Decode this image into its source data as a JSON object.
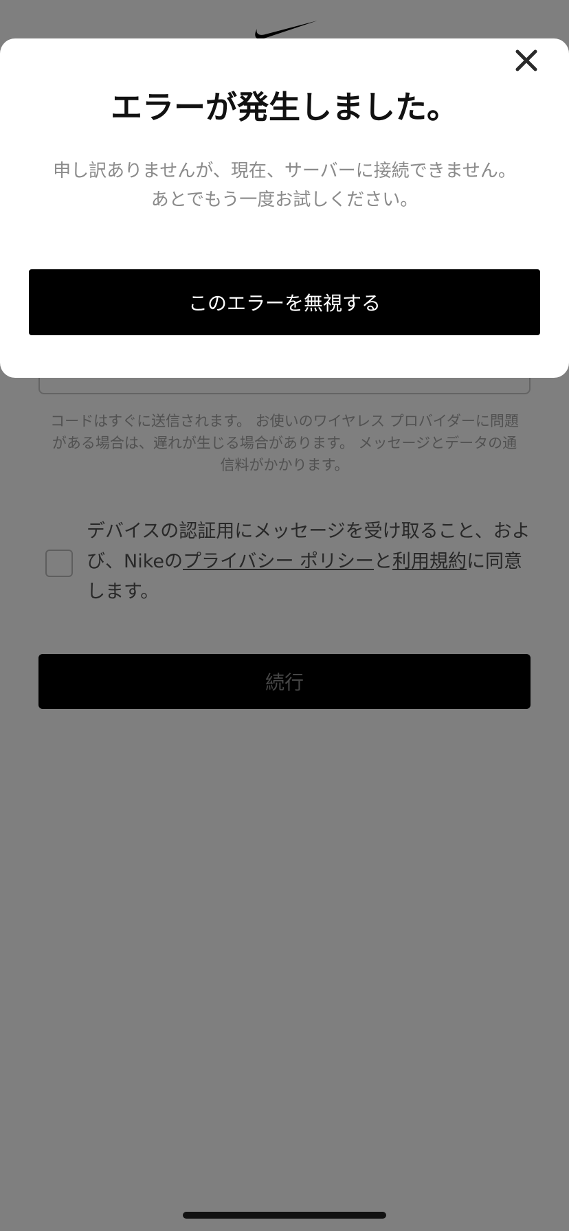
{
  "header": {
    "logo_icon": "nike-swoosh-icon"
  },
  "modal": {
    "close_icon": "close-icon",
    "title": "エラーが発生しました。",
    "message_line1": "申し訳ありませんが、現在、サーバーに接続できません。",
    "message_line2": "あとでもう一度お試しください。",
    "ignore_button_label": "このエラーを無視する"
  },
  "form": {
    "info_line1": "コードはすぐに送信されます。 お使いのワイヤレス プロバイダーに問題",
    "info_line2": "がある場合は、遅れが生じる場合があります。 メッセージとデータの通",
    "info_line3": "信料がかかります。",
    "consent_part1": "デバイスの認証用にメッセージを受け取ること、および、Nikeの",
    "consent_link_privacy": "プライバシー ポリシー",
    "consent_part2": "と",
    "consent_link_terms": "利用規約",
    "consent_part3": "に同意します。",
    "consent_checked": false,
    "continue_label": "続行"
  },
  "colors": {
    "overlay": "#000000",
    "button_bg": "#000000",
    "modal_bg": "#ffffff"
  }
}
